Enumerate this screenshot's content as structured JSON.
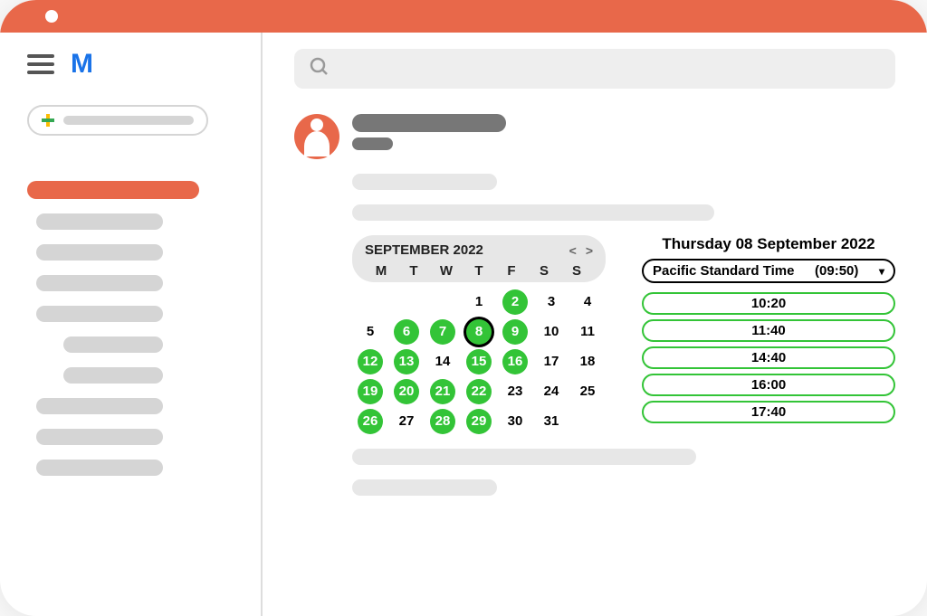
{
  "calendar": {
    "month_label": "SEPTEMBER 2022",
    "dow": [
      "M",
      "T",
      "W",
      "T",
      "F",
      "S",
      "S"
    ],
    "weeks": [
      [
        {
          "n": "",
          "s": 0
        },
        {
          "n": "",
          "s": 0
        },
        {
          "n": "",
          "s": 0
        },
        {
          "n": "1",
          "s": 0
        },
        {
          "n": "2",
          "s": 1
        },
        {
          "n": "3",
          "s": 0
        },
        {
          "n": "4",
          "s": 0
        }
      ],
      [
        {
          "n": "5",
          "s": 0
        },
        {
          "n": "6",
          "s": 1
        },
        {
          "n": "7",
          "s": 1
        },
        {
          "n": "8",
          "s": 2
        },
        {
          "n": "9",
          "s": 1
        },
        {
          "n": "10",
          "s": 0
        },
        {
          "n": "11",
          "s": 0
        }
      ],
      [
        {
          "n": "12",
          "s": 1
        },
        {
          "n": "13",
          "s": 1
        },
        {
          "n": "14",
          "s": 0
        },
        {
          "n": "15",
          "s": 1
        },
        {
          "n": "16",
          "s": 1
        },
        {
          "n": "17",
          "s": 0
        },
        {
          "n": "18",
          "s": 0
        }
      ],
      [
        {
          "n": "19",
          "s": 1
        },
        {
          "n": "20",
          "s": 1
        },
        {
          "n": "21",
          "s": 1
        },
        {
          "n": "22",
          "s": 1
        },
        {
          "n": "23",
          "s": 0
        },
        {
          "n": "24",
          "s": 0
        },
        {
          "n": "25",
          "s": 0
        }
      ],
      [
        {
          "n": "26",
          "s": 1
        },
        {
          "n": "27",
          "s": 0
        },
        {
          "n": "28",
          "s": 1
        },
        {
          "n": "29",
          "s": 1
        },
        {
          "n": "30",
          "s": 0
        },
        {
          "n": "31",
          "s": 0
        },
        {
          "n": "",
          "s": 0
        }
      ]
    ]
  },
  "times": {
    "selected_date": "Thursday 08 September 2022",
    "tz_name": "Pacific Standard Time",
    "tz_time": "(09:50)",
    "slots": [
      "10:20",
      "11:40",
      "14:40",
      "16:00",
      "17:40"
    ]
  }
}
